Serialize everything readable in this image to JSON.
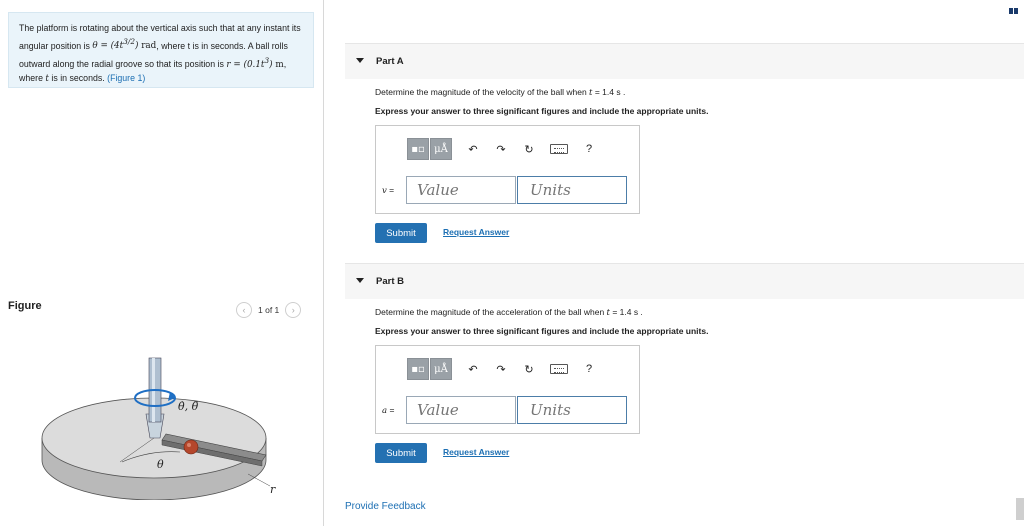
{
  "problem": {
    "text1": "The platform is rotating about the vertical axis such that at any instant its angular position is ",
    "theta_expr": "θ = (4t",
    "theta_exp": "3/2",
    "theta_close": ")",
    "theta_unit": "rad",
    "text2": ", where t is in seconds. A ball rolls outward along the radial groove so that its position is ",
    "r_expr": "r = (0.1t",
    "r_exp": "3",
    "r_close": ")",
    "r_unit": "m",
    "text3": ", where ",
    "t_var": "t",
    "text4": " is in seconds. ",
    "figure_link": "(Figure 1)"
  },
  "figure": {
    "label": "Figure",
    "pager": "1 of 1",
    "prev_icon": "chevron-left-icon",
    "next_icon": "chevron-right-icon",
    "theta_dots_label": "θ̇, θ̈",
    "theta_label": "θ",
    "r_label": "r"
  },
  "partA": {
    "title": "Part A",
    "question_pre": "Determine the magnitude of the velocity of the ball when ",
    "question_var": "t",
    "question_post": " = 1.4 s .",
    "instruction": "Express your answer to three significant figures and include the appropriate units.",
    "var": "v",
    "eq": " =",
    "value_placeholder": "Value",
    "units_placeholder": "Units",
    "submit": "Submit",
    "request": "Request Answer"
  },
  "partB": {
    "title": "Part B",
    "question_pre": "Determine the magnitude of the acceleration of the ball when ",
    "question_var": "t",
    "question_post": " = 1.4 s .",
    "instruction": "Express your answer to three significant figures and include the appropriate units.",
    "var": "a",
    "eq": " =",
    "value_placeholder": "Value",
    "units_placeholder": "Units",
    "submit": "Submit",
    "request": "Request Answer"
  },
  "toolbar": {
    "templates_icon": "templates-icon",
    "mu_label": "μÅ",
    "undo_icon": "undo-icon",
    "redo_icon": "redo-icon",
    "reset_icon": "reset-icon",
    "keyboard_icon": "keyboard-icon",
    "help_label": "?"
  },
  "footer": {
    "feedback": "Provide Feedback"
  },
  "colors": {
    "accent": "#2471b2",
    "link": "#1c6fb3",
    "problem_bg": "#eaf4fa"
  }
}
